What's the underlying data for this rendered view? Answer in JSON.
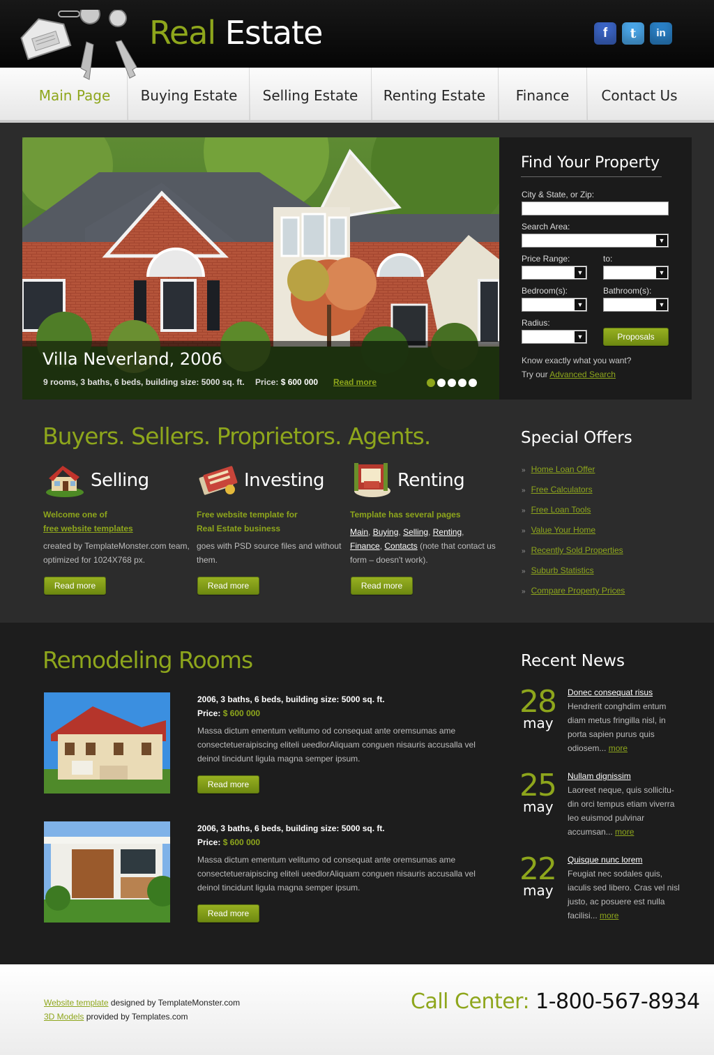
{
  "header": {
    "logo_green": "Real",
    "logo_white": "Estate",
    "social": [
      {
        "name": "facebook-icon",
        "glyph": "f",
        "color": "#3b64c4"
      },
      {
        "name": "twitter-icon",
        "glyph": "t",
        "color": "#4aa6e8"
      },
      {
        "name": "linkedin-icon",
        "glyph": "in",
        "color": "#2a80c6"
      }
    ]
  },
  "nav": {
    "items": [
      "Main Page",
      "Buying Estate",
      "Selling Estate",
      "Renting Estate",
      "Finance",
      "Contact Us"
    ],
    "active_color": "#8ea61c"
  },
  "hero": {
    "title": "Villa Neverland, 2006",
    "info": "9 rooms, 3 baths, 6 beds, building size: 5000 sq. ft.",
    "price_label": "Price:",
    "price_value": "$ 600 000",
    "more": "Read more",
    "slides": 5,
    "active_slide": 1
  },
  "search": {
    "title": "Find Your Property",
    "city_label": "City & State, or Zip:",
    "area_label": "Search Area:",
    "price_label": "Price Range:",
    "to_label": "to:",
    "bedroom_label": "Bedroom(s):",
    "bathroom_label": "Bathroom(s):",
    "radius_label": "Radius:",
    "button": "Proposals",
    "know": "Know exactly what you want?",
    "try": "Try our",
    "advanced": "Advanced Search"
  },
  "buyers": {
    "title": "Buyers. Sellers. Proprietors. Agents.",
    "features": [
      {
        "title": "Selling",
        "icon": "house-icon",
        "head1": "Welcome one of",
        "head2": "free website templates",
        "body": "created by TemplateMonster.com team, optimized for 1024X768 px.",
        "button": "Read more"
      },
      {
        "title": "Investing",
        "icon": "money-icon",
        "head1": "Free website template for",
        "head2": "Real Estate business",
        "body": "goes with PSD source files and without them.",
        "button": "Read more"
      },
      {
        "title": "Renting",
        "icon": "room-icon",
        "head1": "Template has several pages",
        "links": [
          "Main",
          "Buying",
          "Selling",
          "Renting",
          "Finance",
          "Contacts"
        ],
        "note": "(note that contact us form – doesn't work).",
        "button": "Read more"
      }
    ]
  },
  "offers": {
    "title": "Special Offers",
    "items": [
      "Home Loan Offer",
      "Free Calculators",
      "Free Loan Tools",
      "Value Your Home",
      "Recently Sold Properties",
      "Suburb Statistics",
      "Compare Property Prices"
    ]
  },
  "remodeling": {
    "title": "Remodeling Rooms",
    "listings": [
      {
        "head": "2006, 3 baths, 6 beds, building size: 5000 sq. ft.",
        "price_label": "Price:",
        "price_value": "$ 600 000",
        "body": "Massa dictum ementum velitumo od consequat ante oremsumas ame consectetueraipiscing eliteli ueedlorAliquam conguen nisauris accusalla vel deinol tincidunt ligula magna semper ipsum.",
        "button": "Read more"
      },
      {
        "head": "2006, 3 baths, 6 beds, building size: 5000 sq. ft.",
        "price_label": "Price:",
        "price_value": "$ 600 000",
        "body": "Massa dictum ementum velitumo od consequat ante oremsumas ame consectetueraipiscing eliteli ueedlorAliquam conguen nisauris accusalla vel deinol tincidunt ligula magna semper ipsum.",
        "button": "Read more"
      }
    ]
  },
  "news": {
    "title": "Recent News",
    "items": [
      {
        "day": "28",
        "month": "may",
        "head": "Donec consequat risus",
        "body": "Hendrerit conghdim entum diam metus fringilla nisl, in porta sapien purus quis odiosem...",
        "more": "more"
      },
      {
        "day": "25",
        "month": "may",
        "head": "Nullam dignissim",
        "body": "Laoreet neque, quis sollicitu-din orci tempus etiam viverra leo euismod pulvinar accumsan...",
        "more": "more"
      },
      {
        "day": "22",
        "month": "may",
        "head": "Quisque nunc lorem",
        "body": "Feugiat nec sodales quis, iaculis sed libero. Cras vel nisl justo, ac posuere est nulla facilisi...",
        "more": "more"
      }
    ]
  },
  "footer": {
    "link1": "Website template",
    "text1": "designed by TemplateMonster.com",
    "link2": "3D Models",
    "text2": "provided by Templates.com",
    "call_label": "Call Center:",
    "call_number": "1-800-567-8934"
  },
  "colors": {
    "accent": "#8ea61c",
    "dark": "#2c2c2c",
    "darker": "#1d1d1d"
  }
}
